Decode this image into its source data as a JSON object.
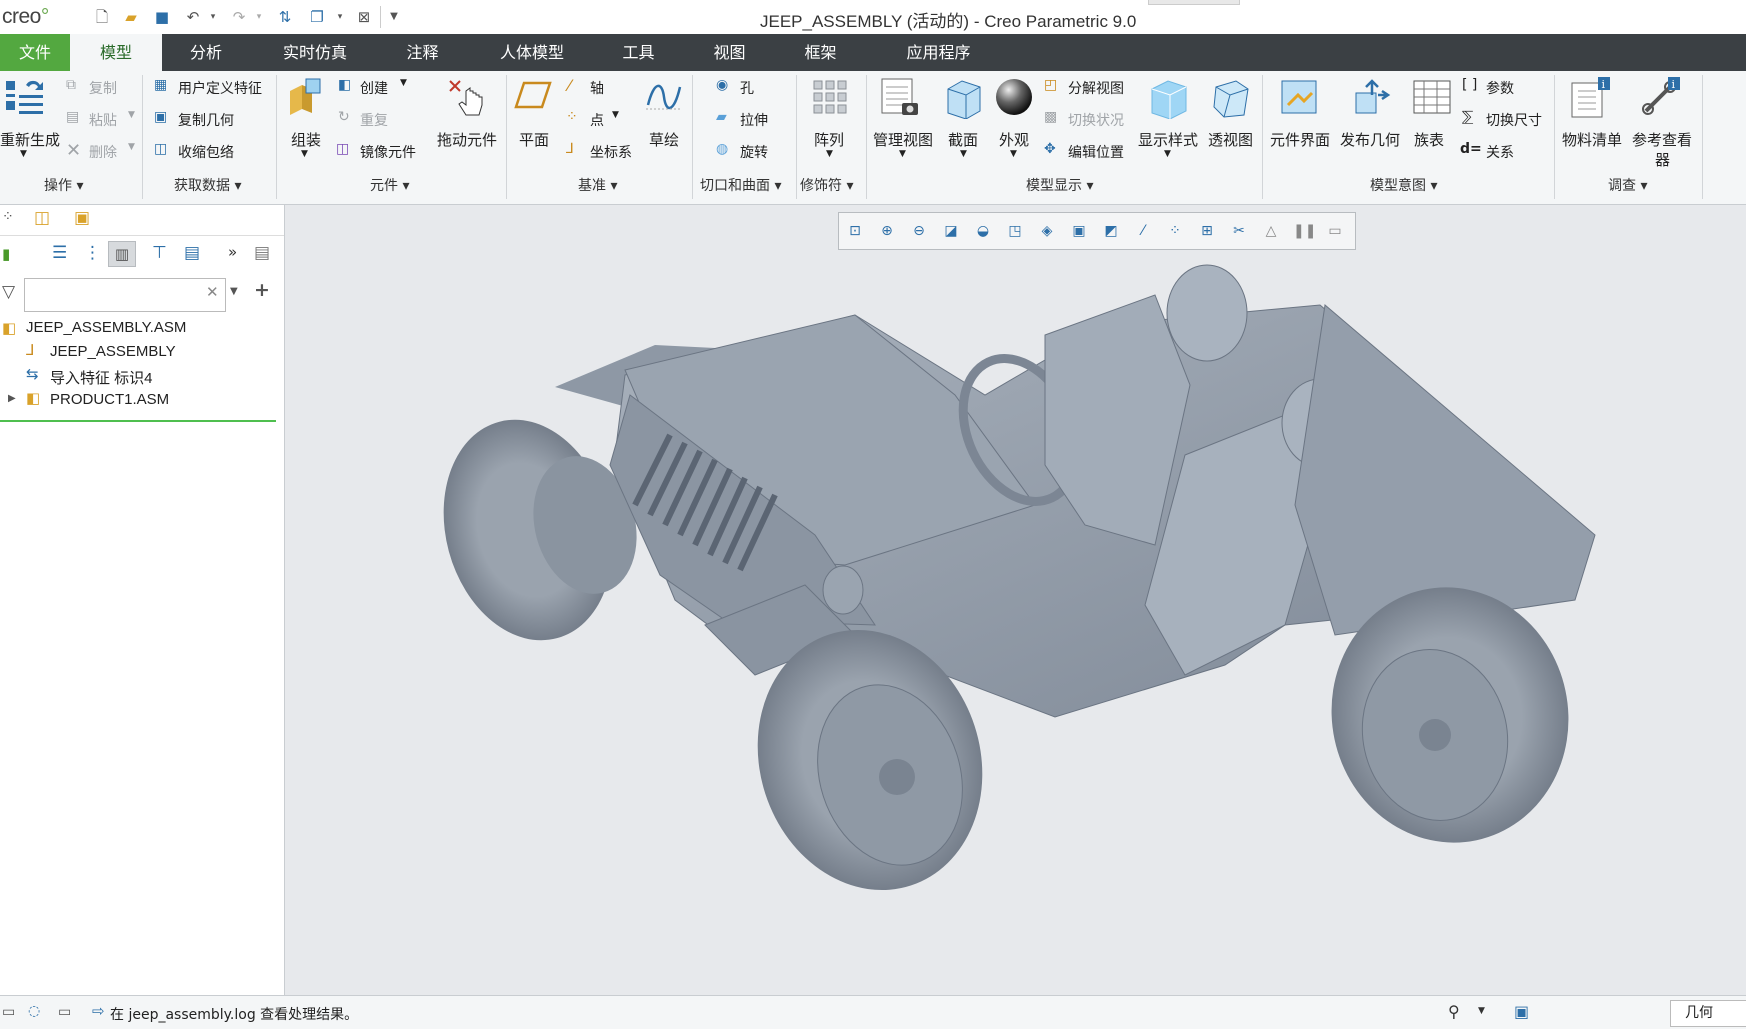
{
  "app": {
    "logo": "creo",
    "window_title": "JEEP_ASSEMBLY (活动的) - Creo Parametric 9.0"
  },
  "menubar": {
    "items": [
      "文件",
      "模型",
      "分析",
      "实时仿真",
      "注释",
      "人体模型",
      "工具",
      "视图",
      "框架",
      "应用程序"
    ],
    "active": "模型"
  },
  "ribbon": {
    "operations": {
      "regenerate": "重新生成",
      "copy": "复制",
      "paste": "粘贴",
      "delete": "删除",
      "group": "操作"
    },
    "get_data": {
      "udf": "用户定义特征",
      "copy_geom": "复制几何",
      "shrinkwrap": "收缩包络",
      "group": "获取数据"
    },
    "component": {
      "assemble": "组装",
      "create": "创建",
      "repeat": "重复",
      "mirror": "镜像元件",
      "drag": "拖动元件",
      "group": "元件"
    },
    "datum": {
      "plane": "平面",
      "axis": "轴",
      "point": "点",
      "csys": "坐标系",
      "sketch": "草绘",
      "group": "基准"
    },
    "cut_surface": {
      "hole": "孔",
      "extrude": "拉伸",
      "revolve": "旋转",
      "group": "切口和曲面"
    },
    "modifiers": {
      "pattern": "阵列",
      "group": "修饰符"
    },
    "model_display": {
      "manage_views": "管理视图",
      "section": "截面",
      "appearance": "外观",
      "explode": "分解视图",
      "toggle_status": "切换状况",
      "edit_position": "编辑位置",
      "display_style": "显示样式",
      "perspective": "透视图",
      "group": "模型显示"
    },
    "model_intent": {
      "component_interface": "元件界面",
      "publish_geom": "发布几何",
      "family_table": "族表",
      "parameters": "参数",
      "switch_dims": "切换尺寸",
      "relations": "关系",
      "group": "模型意图"
    },
    "investigate": {
      "bom": "物料清单",
      "reference_viewer_1": "参考查看",
      "reference_viewer_2": "器",
      "group": "调查"
    }
  },
  "model_tree": {
    "filter_placeholder": "",
    "items": [
      {
        "label": "JEEP_ASSEMBLY.ASM",
        "icon": "assembly-icon"
      },
      {
        "label": "JEEP_ASSEMBLY",
        "icon": "csys-icon"
      },
      {
        "label": "导入特征 标识4",
        "icon": "import-feature-icon"
      },
      {
        "label": "PRODUCT1.ASM",
        "icon": "assembly-icon"
      }
    ]
  },
  "status": {
    "message": "在 jeep_assembly.log 查看处理结果。",
    "filter": "几何"
  },
  "colors": {
    "menubar": "#3b4044",
    "file_tab": "#53a840",
    "ribbon": "#f4f6f7",
    "viewport": "#e7e9ec",
    "model": "#8e97a3"
  }
}
